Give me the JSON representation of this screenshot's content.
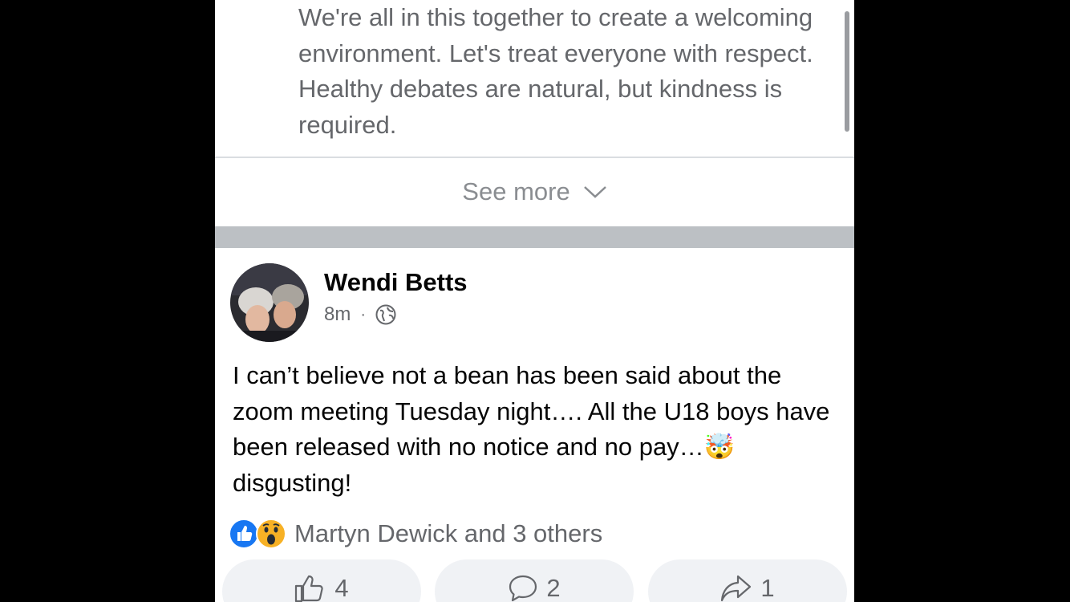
{
  "rules": {
    "text": "We're all in this together to create a welcoming environment. Let's treat everyone with respect. Healthy debates are natural, but kindness is required.",
    "see_more_label": "See more"
  },
  "post": {
    "author": "Wendi Betts",
    "time": "8m",
    "body_text": "I can’t believe not a bean has been said about the zoom meeting Tuesday night…. All the U18 boys have been released with no notice and no pay…",
    "body_emoji": "🤯",
    "body_tail": " disgusting!",
    "reactions_text": "Martyn Dewick and 3 others",
    "reactions": [
      "like",
      "wow"
    ]
  },
  "actions": {
    "like_count": "4",
    "comment_count": "2",
    "share_count": "1"
  },
  "colors": {
    "like_blue": "#1877f2",
    "text_secondary": "#65676b",
    "separator": "#bcc0c4"
  }
}
